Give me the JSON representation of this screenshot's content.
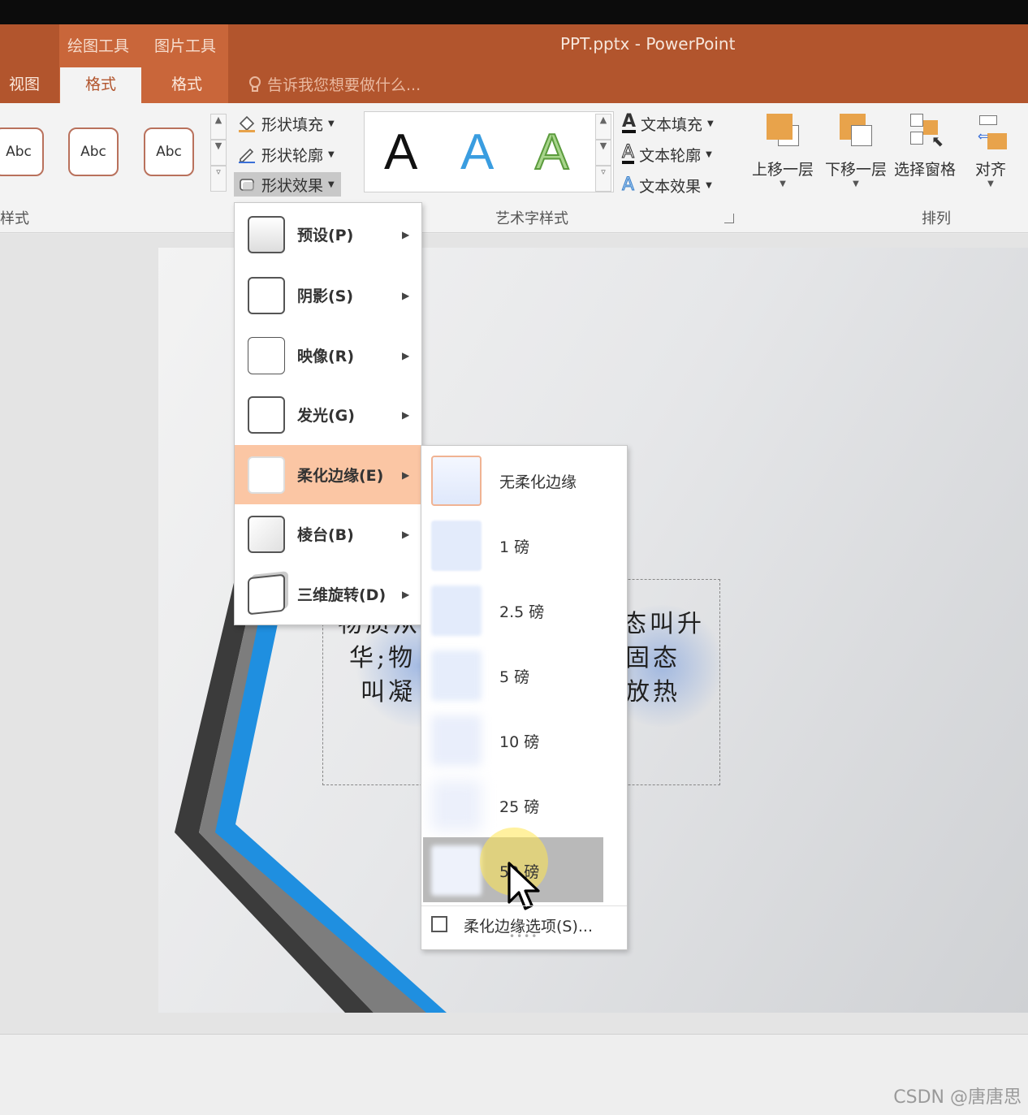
{
  "window": {
    "title": "PPT.pptx - PowerPoint",
    "context_groups": [
      "绘图工具",
      "图片工具"
    ]
  },
  "tabs": [
    {
      "label": "视图",
      "active": false
    },
    {
      "label": "格式",
      "active": true
    },
    {
      "label": "格式",
      "active": false
    }
  ],
  "tell_me": {
    "placeholder": "告诉我您想要做什么..."
  },
  "shape_styles": {
    "thumbnails": [
      "Abc",
      "Abc",
      "Abc"
    ],
    "group_label": "样式"
  },
  "shape_commands": {
    "fill": "形状填充",
    "outline": "形状轮廓",
    "effects": "形状效果"
  },
  "wordart": {
    "samples": [
      "A",
      "A",
      "A"
    ],
    "group_label": "艺术字样式",
    "fill": "文本填充",
    "outline": "文本轮廓",
    "effects": "文本效果"
  },
  "arrange": {
    "group_label": "排列",
    "buttons": [
      "上移一层",
      "下移一层",
      "选择窗格",
      "对齐"
    ]
  },
  "effects_menu": {
    "items": [
      {
        "label": "预设(P)"
      },
      {
        "label": "阴影(S)"
      },
      {
        "label": "映像(R)"
      },
      {
        "label": "发光(G)"
      },
      {
        "label": "柔化边缘(E)",
        "highlighted": true
      },
      {
        "label": "棱台(B)"
      },
      {
        "label": "三维旋转(D)"
      }
    ]
  },
  "soft_edges_submenu": {
    "items": [
      {
        "label": "无柔化边缘",
        "soft_edge_pt": 0
      },
      {
        "label": "1 磅",
        "soft_edge_pt": 1
      },
      {
        "label": "2.5 磅",
        "soft_edge_pt": 2.5
      },
      {
        "label": "5 磅",
        "soft_edge_pt": 5
      },
      {
        "label": "10 磅",
        "soft_edge_pt": 10
      },
      {
        "label": "25 磅",
        "soft_edge_pt": 25
      },
      {
        "label": "50 磅",
        "soft_edge_pt": 50,
        "selected": true
      }
    ],
    "options_label": "柔化边缘选项(S)..."
  },
  "slide": {
    "text_left_lines": [
      "物质从",
      "华;物",
      "叫凝"
    ],
    "text_right_lines": [
      "态叫升",
      "固态",
      "放热"
    ]
  },
  "watermark": "CSDN @唐唐思",
  "colors": {
    "title_bar": "#b2552d",
    "context_group": "#c9663a",
    "ribbon": "#f3f3f3",
    "menu_highlight": "#fbc6a4",
    "submenu_selected": "#b9b9b9",
    "slide_accent_blue": "#1f8fe0"
  }
}
